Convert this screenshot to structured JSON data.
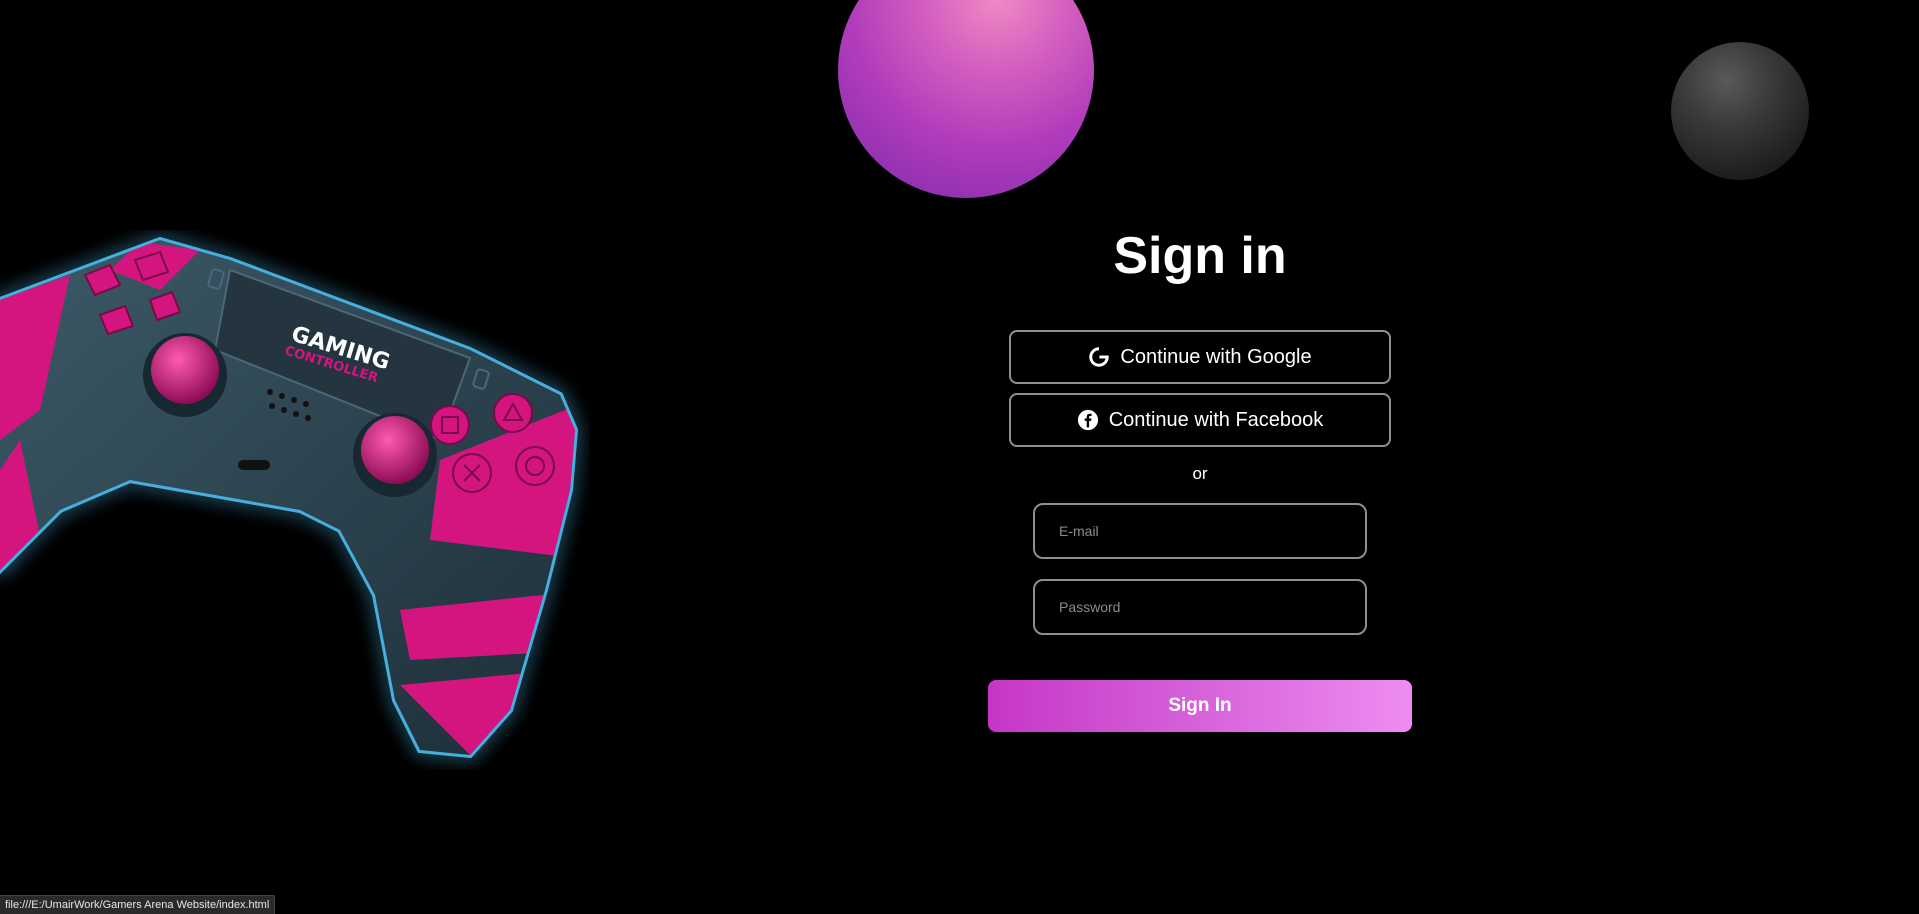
{
  "signin": {
    "title": "Sign in",
    "google_label": "Continue with Google",
    "facebook_label": "Continue with Facebook",
    "or_text": "or",
    "email_placeholder": "E-mail",
    "password_placeholder": "Password",
    "submit_label": "Sign In"
  },
  "controller": {
    "brand_line1": "GAMING",
    "brand_line2": "CONTROLLER"
  },
  "icons": {
    "google": "google-icon",
    "facebook": "facebook-icon"
  },
  "colors": {
    "background": "#000000",
    "accent_start": "#c636c6",
    "accent_end": "#ee8cf2",
    "controller_body": "#2d4552",
    "controller_pink": "#d4157f",
    "controller_glow": "#4fc3f7"
  },
  "status_bar": {
    "url": "file:///E:/UmairWork/Gamers Arena Website/index.html"
  }
}
